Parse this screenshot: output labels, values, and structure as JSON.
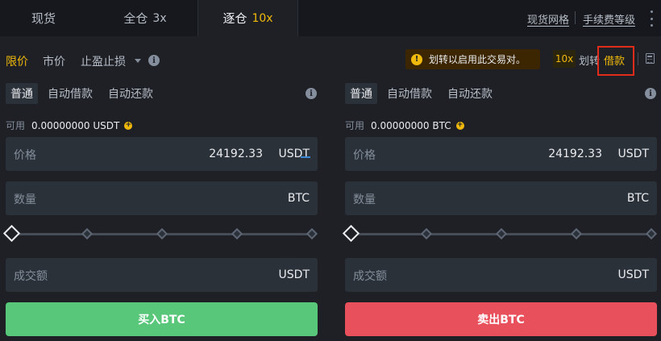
{
  "tabs": [
    {
      "label": "现货",
      "leverage": ""
    },
    {
      "label": "全仓",
      "leverage": "3x"
    },
    {
      "label": "逐仓",
      "leverage": "10x"
    }
  ],
  "top_links": {
    "spot_grid": "现货网格",
    "fee_tier": "手续费等级"
  },
  "order_types": {
    "limit": "限价",
    "market": "市价",
    "stop_limit": "止盈止损"
  },
  "warning": {
    "icon": "!",
    "text": "划转以启用此交易对。"
  },
  "toolbar": {
    "leverage": "10x",
    "transfer": "划转",
    "borrow": "借款"
  },
  "colors": {
    "accent": "#f0b90b",
    "buy": "#58c77a",
    "sell": "#e8505b",
    "highlight_box": "#e12b1b"
  },
  "buy_panel": {
    "modes": [
      "普通",
      "自动借款",
      "自动还款"
    ],
    "available_label": "可用",
    "available_value": "0.00000000 USDT",
    "price_label": "价格",
    "price_value": "24192.33",
    "price_unit": "USDT",
    "amount_label": "数量",
    "amount_unit": "BTC",
    "total_label": "成交额",
    "total_unit": "USDT",
    "slider_percent": 0,
    "action_label": "买入BTC"
  },
  "sell_panel": {
    "modes": [
      "普通",
      "自动借款",
      "自动还款"
    ],
    "available_label": "可用",
    "available_value": "0.00000000 BTC",
    "price_label": "价格",
    "price_value": "24192.33",
    "price_unit": "USDT",
    "amount_label": "数量",
    "amount_unit": "BTC",
    "total_label": "成交额",
    "total_unit": "USDT",
    "slider_percent": 0,
    "action_label": "卖出BTC"
  }
}
